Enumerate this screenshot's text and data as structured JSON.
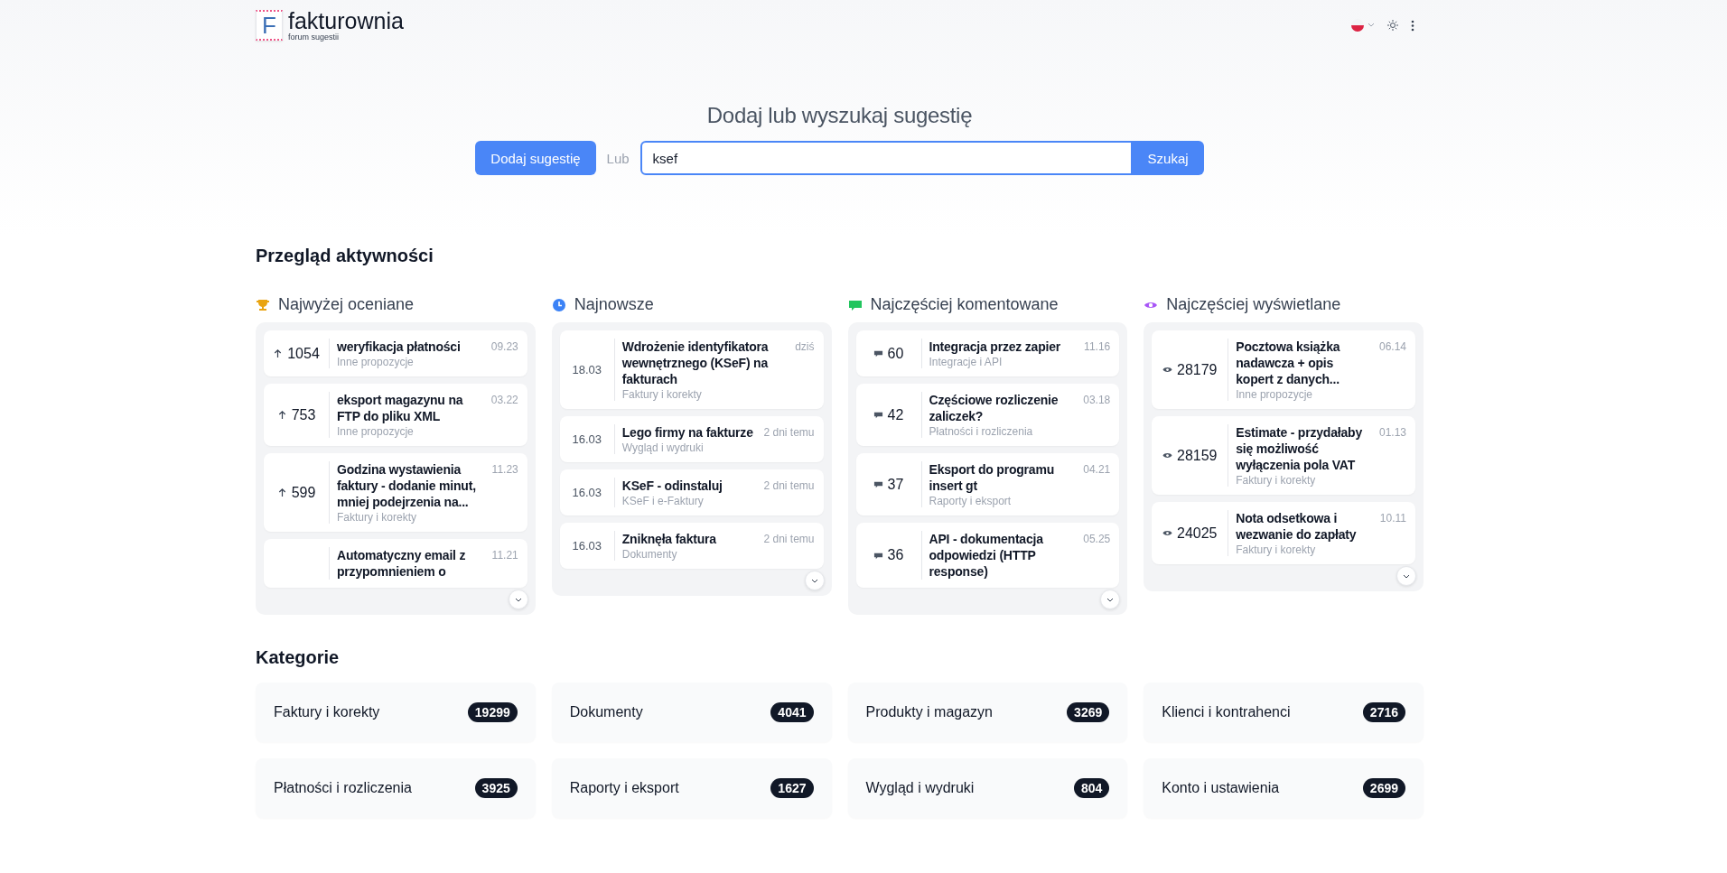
{
  "header": {
    "logo_letter": "F",
    "brand": "fakturownia",
    "tagline": "forum sugestii"
  },
  "hero": {
    "title": "Dodaj lub wyszukaj sugestię",
    "add_button": "Dodaj sugestię",
    "or_label": "Lub",
    "search": {
      "value": "ksef"
    },
    "search_button": "Szukaj"
  },
  "activity": {
    "title": "Przegląd aktywności",
    "columns": [
      {
        "kind": "votes",
        "title": "Najwyżej oceniane",
        "items": [
          {
            "stat": "1054",
            "title": "weryfikacja płatności",
            "category": "Inne propozycje",
            "date": "09.23"
          },
          {
            "stat": "753",
            "title": "eksport magazynu na FTP do pliku XML",
            "category": "Inne propozycje",
            "date": "03.22"
          },
          {
            "stat": "599",
            "title": "Godzina wystawienia faktury - dodanie minut, mniej podejrzenia na...",
            "category": "Faktury i korekty",
            "date": "11.23"
          },
          {
            "title": "Automatyczny email z przypomnieniem o",
            "date": "11.21"
          }
        ]
      },
      {
        "kind": "newest",
        "title": "Najnowsze",
        "items": [
          {
            "stat": "18.03",
            "title": "Wdrożenie identyfikatora wewnętrznego (KSeF) na fakturach",
            "category": "Faktury i korekty",
            "date": "dziś"
          },
          {
            "stat": "16.03",
            "title": "Lego firmy na fakturze",
            "category": "Wygląd i wydruki",
            "date": "2 dni temu"
          },
          {
            "stat": "16.03",
            "title": "KSeF - odinstaluj",
            "category": "KSeF i e-Faktury",
            "date": "2 dni temu"
          },
          {
            "stat": "16.03",
            "title": "Zniknęła faktura",
            "category": "Dokumenty",
            "date": "2 dni temu"
          }
        ]
      },
      {
        "kind": "comments",
        "title": "Najczęściej komentowane",
        "items": [
          {
            "stat": "60",
            "title": "Integracja przez zapier",
            "category": "Integracje i API",
            "date": "11.16"
          },
          {
            "stat": "42",
            "title": "Częściowe rozliczenie zaliczek?",
            "category": "Płatności i rozliczenia",
            "date": "03.18"
          },
          {
            "stat": "37",
            "title": "Eksport do programu insert gt",
            "category": "Raporty i eksport",
            "date": "04.21"
          },
          {
            "stat": "36",
            "title": "API - dokumentacja odpowiedzi (HTTP response)",
            "date": "05.25"
          }
        ]
      },
      {
        "kind": "views",
        "title": "Najczęściej wyświetlane",
        "items": [
          {
            "stat": "28179",
            "title": "Pocztowa książka nadawcza + opis kopert z danych...",
            "category": "Inne propozycje",
            "date": "06.14"
          },
          {
            "stat": "28159",
            "title": "Estimate - przydałaby się możliwość wyłączenia pola VAT",
            "category": "Faktury i korekty",
            "date": "01.13"
          },
          {
            "stat": "24025",
            "title": "Nota odsetkowa i wezwanie do zapłaty",
            "category": "Faktury i korekty",
            "date": "10.11"
          }
        ]
      }
    ]
  },
  "categories": {
    "title": "Kategorie",
    "items": [
      {
        "name": "Faktury i korekty",
        "count": "19299"
      },
      {
        "name": "Dokumenty",
        "count": "4041"
      },
      {
        "name": "Produkty i magazyn",
        "count": "3269"
      },
      {
        "name": "Klienci i kontrahenci",
        "count": "2716"
      },
      {
        "name": "Płatności i rozliczenia",
        "count": "3925"
      },
      {
        "name": "Raporty i eksport",
        "count": "1627"
      },
      {
        "name": "Wygląd i wydruki",
        "count": "804"
      },
      {
        "name": "Konto i ustawienia",
        "count": "2699"
      }
    ]
  }
}
